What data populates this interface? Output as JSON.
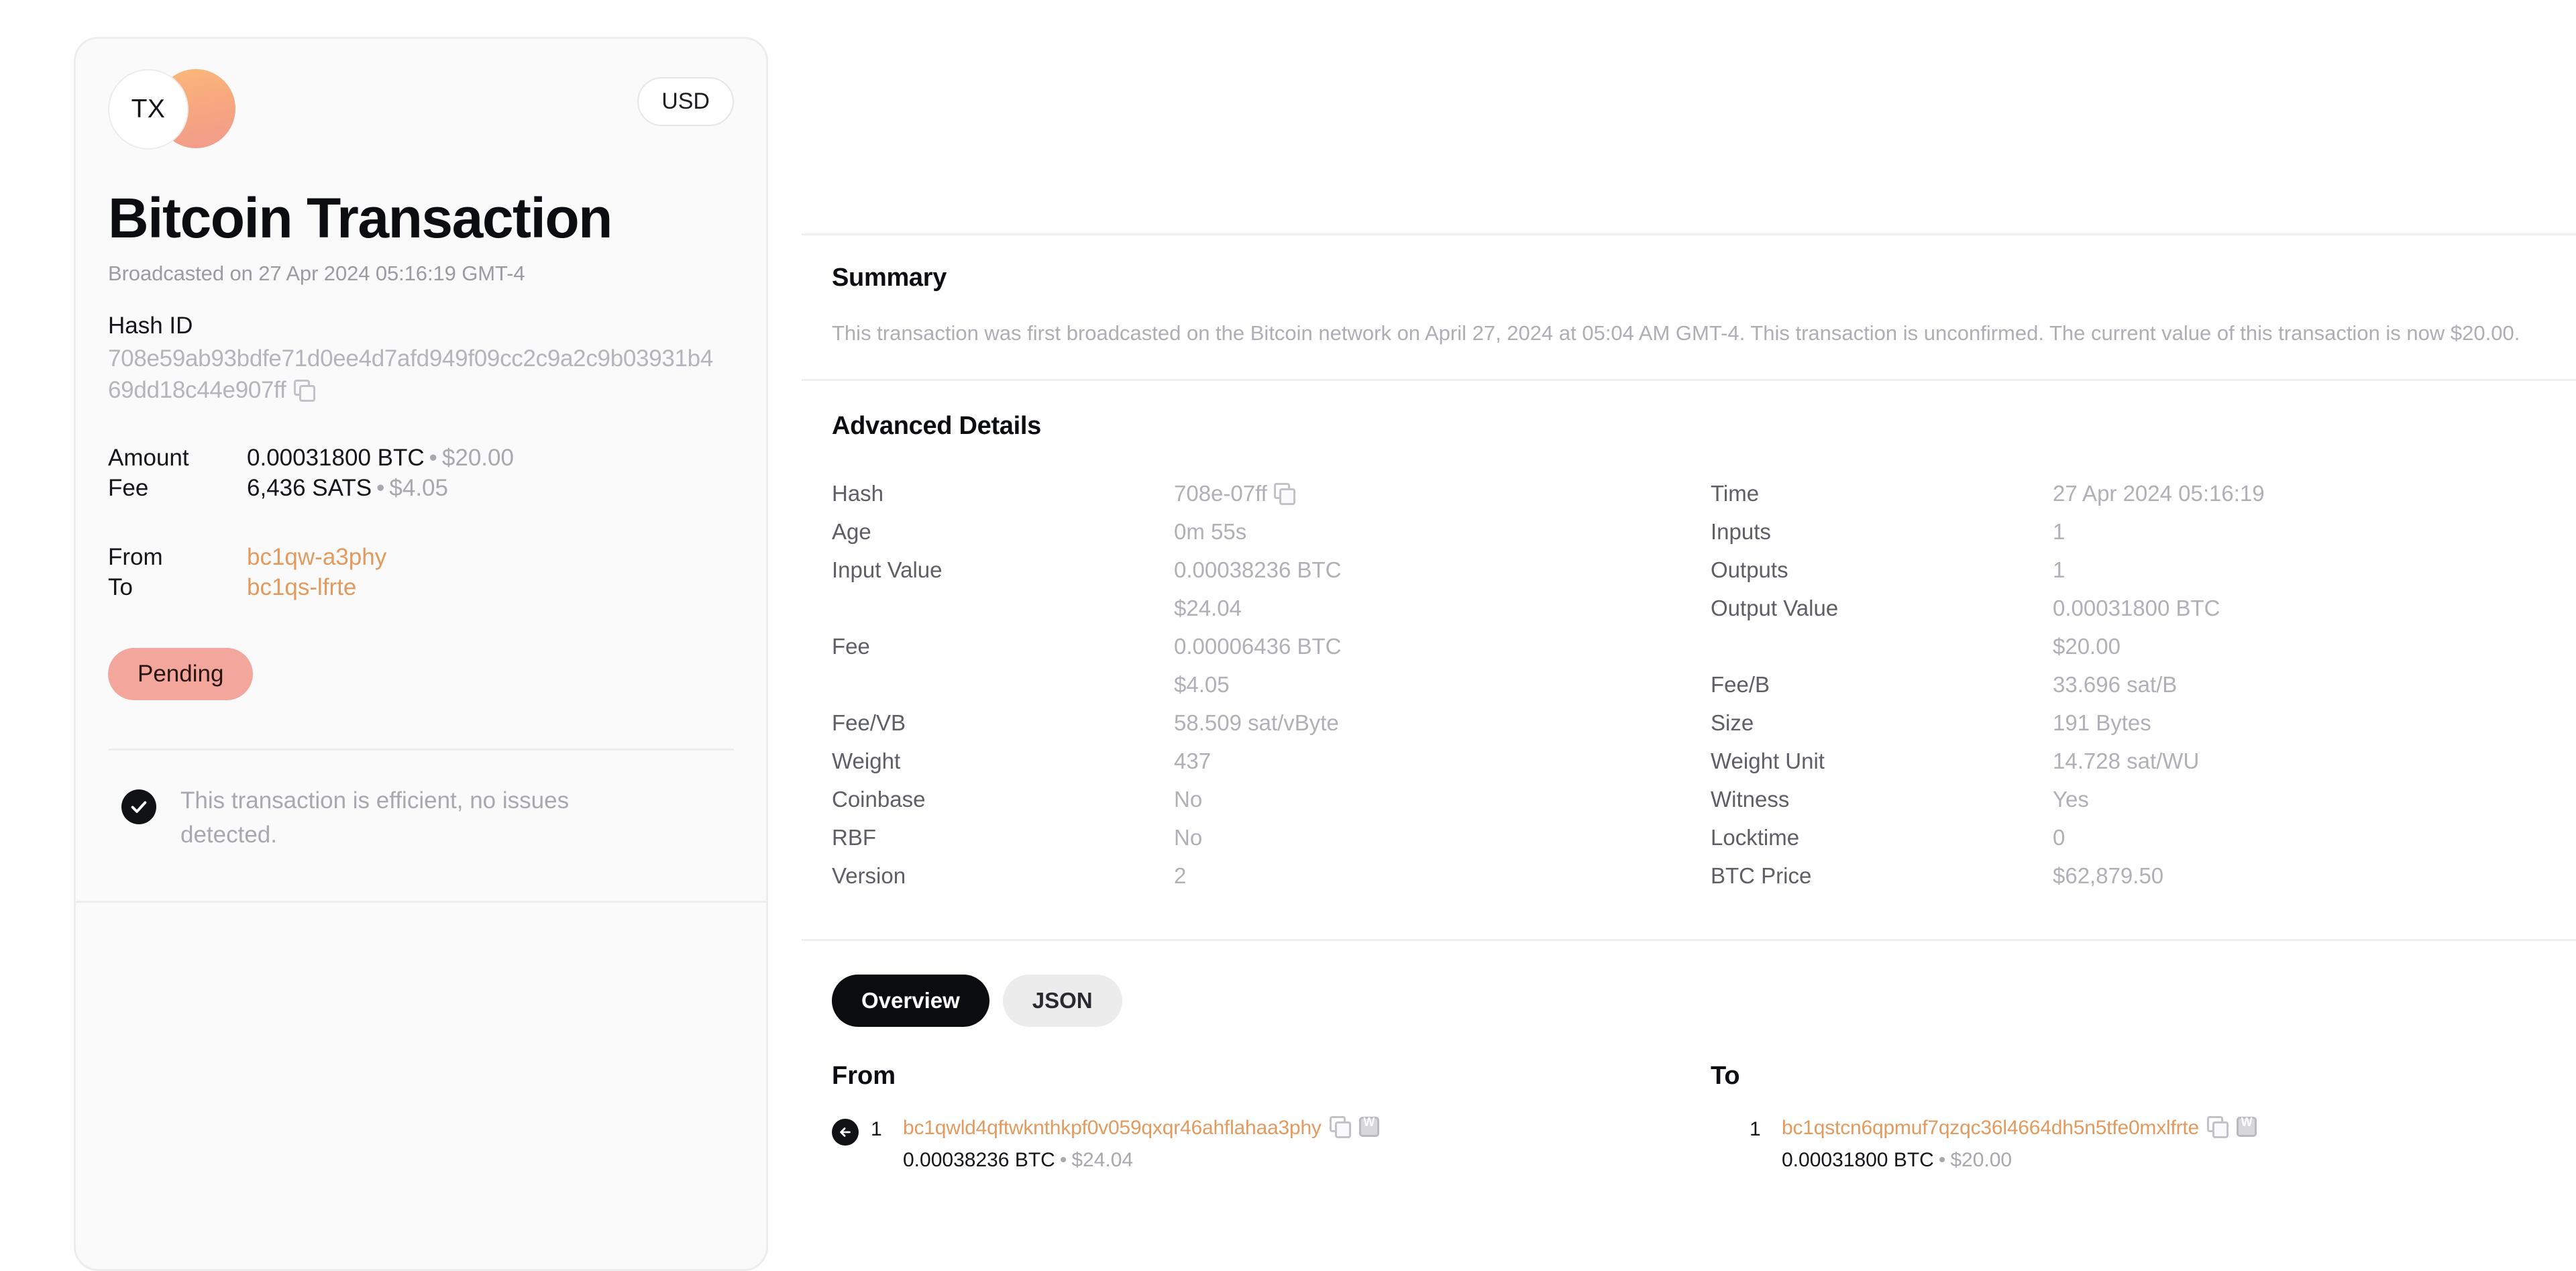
{
  "left_card": {
    "avatar_label": "TX",
    "currency_chip": "USD",
    "title": "Bitcoin Transaction",
    "broadcasted": "Broadcasted on 27 Apr 2024 05:16:19 GMT-4",
    "hash_id_label": "Hash ID",
    "hash_id_value": "708e59ab93bdfe71d0ee4d7afd949f09cc2c9a2c9b03931b469dd18c44e907ff",
    "rows": [
      {
        "key": "Amount",
        "value": "0.00031800 BTC",
        "sub": "$20.00"
      },
      {
        "key": "Fee",
        "value": "6,436 SATS",
        "sub": "$4.05"
      }
    ],
    "addresses": [
      {
        "key": "From",
        "value": "bc1qw-a3phy"
      },
      {
        "key": "To",
        "value": "bc1qs-lfrte"
      }
    ],
    "status": "Pending",
    "efficiency_note": "This transaction is efficient, no issues detected."
  },
  "summary": {
    "title": "Summary",
    "body": "This transaction was first broadcasted on the Bitcoin network on April 27, 2024 at 05:04 AM GMT-4. This transaction is unconfirmed. The current value of this transaction is now $20.00."
  },
  "advanced": {
    "title": "Advanced Details",
    "left_rows": [
      {
        "key": "Hash",
        "value": "708e-07ff",
        "copy": true
      },
      {
        "key": "Age",
        "value": "0m 55s"
      },
      {
        "key": "Input Value",
        "value": "0.00038236 BTC"
      },
      {
        "key": "",
        "value": "$24.04"
      },
      {
        "key": "Fee",
        "value": "0.00006436 BTC"
      },
      {
        "key": "",
        "value": "$4.05"
      },
      {
        "key": "Fee/VB",
        "value": "58.509 sat/vByte"
      },
      {
        "key": "Weight",
        "value": "437"
      },
      {
        "key": "Coinbase",
        "value": "No"
      },
      {
        "key": "RBF",
        "value": "No"
      },
      {
        "key": "Version",
        "value": "2"
      }
    ],
    "right_rows": [
      {
        "key": "Time",
        "value": "27 Apr 2024 05:16:19"
      },
      {
        "key": "Inputs",
        "value": "1"
      },
      {
        "key": "Outputs",
        "value": "1"
      },
      {
        "key": "Output Value",
        "value": "0.00031800 BTC"
      },
      {
        "key": "",
        "value": "$20.00"
      },
      {
        "key": "Fee/B",
        "value": "33.696 sat/B"
      },
      {
        "key": "Size",
        "value": "191 Bytes"
      },
      {
        "key": "Weight Unit",
        "value": "14.728 sat/WU"
      },
      {
        "key": "Witness",
        "value": "Yes"
      },
      {
        "key": "Locktime",
        "value": "0"
      },
      {
        "key": "BTC Price",
        "value": "$62,879.50"
      }
    ]
  },
  "io": {
    "tabs": [
      {
        "label": "Overview",
        "active": true
      },
      {
        "label": "JSON",
        "active": false
      }
    ],
    "from": {
      "heading": "From",
      "index": "1",
      "address": "bc1qwld4qftwknthkpf0v059qxqr46ahflahaa3phy",
      "amount_btc": "0.00038236 BTC",
      "amount_usd": "$24.04"
    },
    "to": {
      "heading": "To",
      "index": "1",
      "address": "bc1qstcn6qpmuf7qzqc36l4664dh5n5tfe0mxlfrte",
      "amount_btc": "0.00031800 BTC",
      "amount_usd": "$20.00"
    }
  },
  "colors": {
    "accent_orange": "#e39a5e",
    "pending_bg": "#f3a79c",
    "tab_active_bg": "#0b0c0f"
  }
}
